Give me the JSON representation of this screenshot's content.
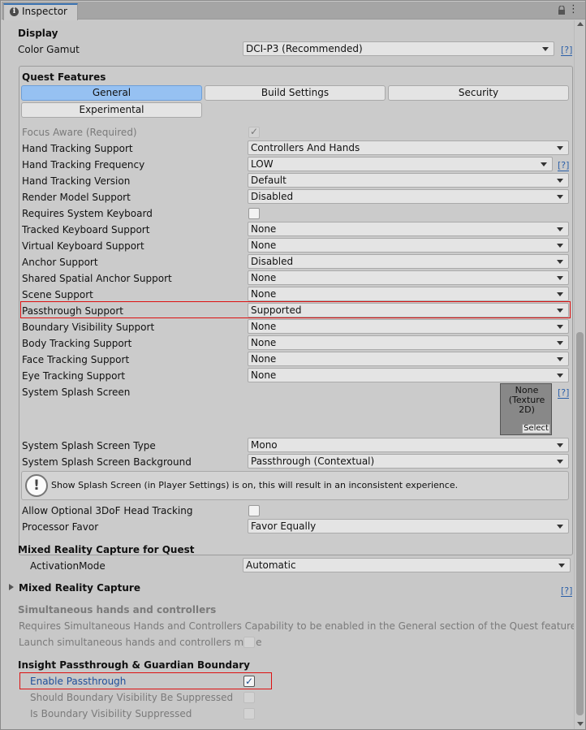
{
  "window": {
    "tab_title": "Inspector",
    "info_icon": "i",
    "menu_icon": "⋮"
  },
  "display": {
    "heading": "Display",
    "color_gamut_label": "Color Gamut",
    "color_gamut_value": "DCI-P3 (Recommended)",
    "help": "[?]"
  },
  "quest": {
    "heading": "Quest Features",
    "tabs": [
      "General",
      "Build Settings",
      "Security",
      "Experimental"
    ],
    "active_tab": "General",
    "help": "[?]",
    "rows": [
      {
        "label": "Focus Aware (Required)",
        "type": "checkbox",
        "checked": true,
        "disabled": true
      },
      {
        "label": "Hand Tracking Support",
        "type": "dropdown",
        "value": "Controllers And Hands"
      },
      {
        "label": "Hand Tracking Frequency",
        "type": "dropdown",
        "value": "LOW",
        "help": true
      },
      {
        "label": "Hand Tracking Version",
        "type": "dropdown",
        "value": "Default"
      },
      {
        "label": "Render Model Support",
        "type": "dropdown",
        "value": "Disabled"
      },
      {
        "label": "Requires System Keyboard",
        "type": "checkbox",
        "checked": false
      },
      {
        "label": "Tracked Keyboard Support",
        "type": "dropdown",
        "value": "None"
      },
      {
        "label": "Virtual Keyboard Support",
        "type": "dropdown",
        "value": "None"
      },
      {
        "label": "Anchor Support",
        "type": "dropdown",
        "value": "Disabled"
      },
      {
        "label": "Shared Spatial Anchor Support",
        "type": "dropdown",
        "value": "None"
      },
      {
        "label": "Scene Support",
        "type": "dropdown",
        "value": "None"
      },
      {
        "label": "Passthrough Support",
        "type": "dropdown",
        "value": "Supported",
        "highlight": true
      },
      {
        "label": "Boundary Visibility Support",
        "type": "dropdown",
        "value": "None"
      },
      {
        "label": "Body Tracking Support",
        "type": "dropdown",
        "value": "None"
      },
      {
        "label": "Face Tracking Support",
        "type": "dropdown",
        "value": "None"
      },
      {
        "label": "Eye Tracking Support",
        "type": "dropdown",
        "value": "None"
      }
    ],
    "splash": {
      "label": "System Splash Screen",
      "texture_name": "None\n(Texture 2D)",
      "texture_line1": "None",
      "texture_line2": "(Texture 2D)",
      "select_label": "Select"
    },
    "splash_type": {
      "label": "System Splash Screen Type",
      "value": "Mono"
    },
    "splash_bg": {
      "label": "System Splash Screen Background",
      "value": "Passthrough (Contextual)"
    },
    "warning_icon": "!",
    "warning_text": "Show Splash Screen (in Player Settings) is on, this will result in an inconsistent experience.",
    "optional_3dof": {
      "label": "Allow Optional 3DoF Head Tracking",
      "checked": false
    },
    "processor_favor": {
      "label": "Processor Favor",
      "value": "Favor Equally"
    }
  },
  "mrc_quest": {
    "heading": "Mixed Reality Capture for Quest",
    "activation_label": "ActivationMode",
    "activation_value": "Automatic"
  },
  "mrc": {
    "heading": "Mixed Reality Capture",
    "help": "[?]"
  },
  "simultaneous": {
    "heading": "Simultaneous hands and controllers",
    "note": "Requires Simultaneous Hands and Controllers Capability to be enabled in the General section of the Quest features.",
    "launch_label": "Launch simultaneous hands and controllers mode"
  },
  "insight": {
    "heading": "Insight Passthrough & Guardian Boundary",
    "enable_label": "Enable Passthrough",
    "enable_checked": true,
    "suppress_label": "Should Boundary Visibility Be Suppressed",
    "suppressed_label": "Is Boundary Visibility Suppressed"
  }
}
